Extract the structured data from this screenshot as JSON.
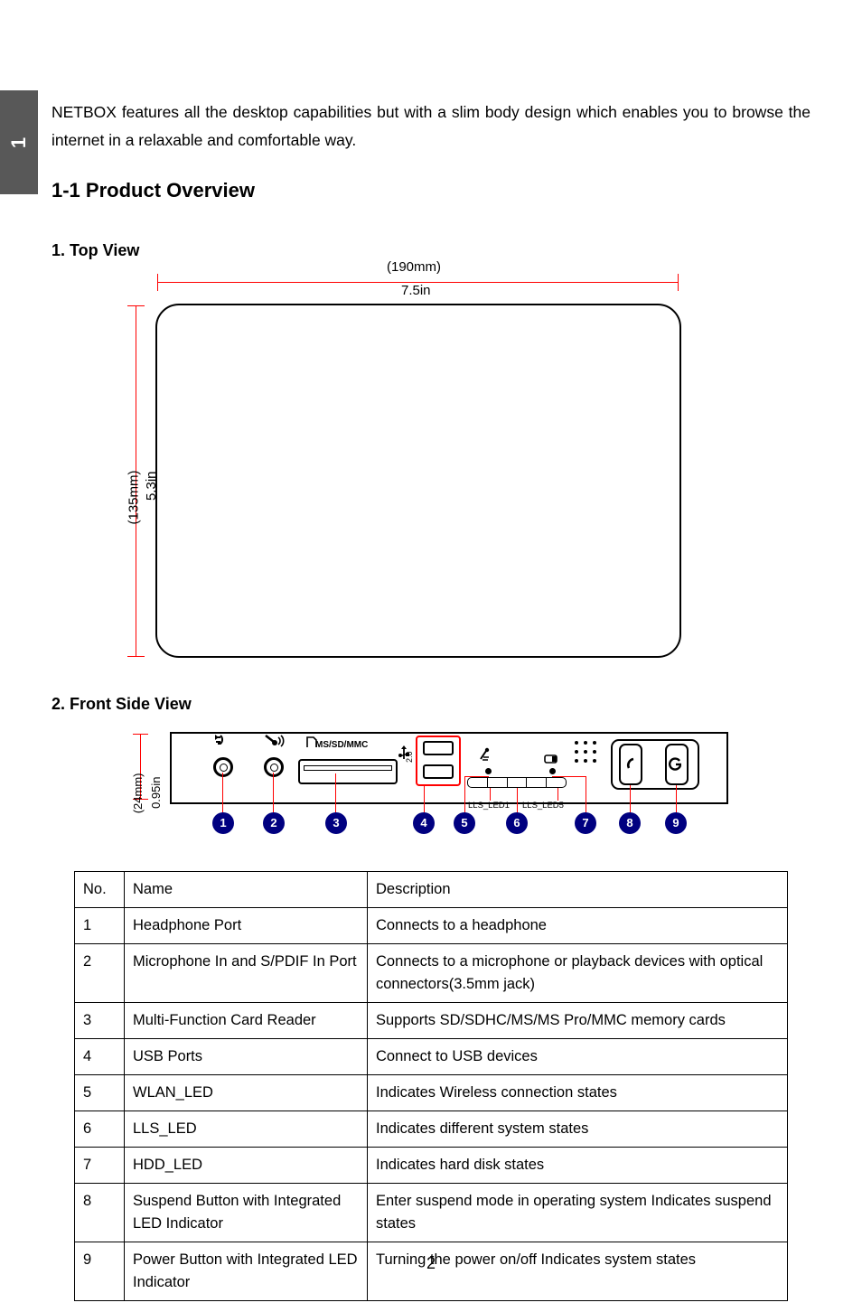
{
  "chapter_tab": {
    "number": "1"
  },
  "intro": {
    "paragraph": "NETBOX features all the desktop capabilities but with a slim body design which enables you to browse the internet in a relaxable and comfortable way."
  },
  "headings": {
    "section": "1-1 Product Overview",
    "top_view": "1. Top View",
    "front_side_view": "2. Front Side View"
  },
  "top_view_diagram": {
    "width_mm": "(190mm)",
    "width_in": "7.5in",
    "height_in": "5.3in",
    "height_mm": "(135mm)"
  },
  "front_view_diagram": {
    "height_in": "0.95in",
    "height_mm": "(24mm)",
    "card_reader_label": "MS/SD/MMC",
    "usb_label": "2.0",
    "led_first_label": "LLS_LED1",
    "led_last_label": "LLS_LED5",
    "icons": {
      "headphone": "headphone-icon",
      "microphone": "microphone-icon",
      "card": "memory-card-icon",
      "usb": "usb-icon",
      "wlan": "wlan-icon",
      "hdd": "hdd-icon",
      "speaker": "speaker-grille-icon",
      "suspend": "moon-icon",
      "power": "power-icon"
    },
    "callouts": [
      "1",
      "2",
      "3",
      "4",
      "5",
      "6",
      "7",
      "8",
      "9"
    ]
  },
  "spec_table": {
    "headers": {
      "no": "No.",
      "name": "Name",
      "description": "Description"
    },
    "rows": [
      {
        "no": "1",
        "name": "Headphone Port",
        "description": "Connects to a headphone"
      },
      {
        "no": "2",
        "name": "Microphone In and S/PDIF In Port",
        "description": "Connects to a microphone or playback devices with optical connectors(3.5mm jack)"
      },
      {
        "no": "3",
        "name": "Multi-Function Card Reader",
        "description": "Supports SD/SDHC/MS/MS Pro/MMC memory cards"
      },
      {
        "no": "4",
        "name": "USB Ports",
        "description": "Connect to USB devices"
      },
      {
        "no": "5",
        "name": "WLAN_LED",
        "description": "Indicates Wireless connection states"
      },
      {
        "no": "6",
        "name": "LLS_LED",
        "description": "Indicates different system states"
      },
      {
        "no": "7",
        "name": "HDD_LED",
        "description": "Indicates hard disk states"
      },
      {
        "no": "8",
        "name": "Suspend Button with Integrated LED Indicator",
        "description": "Enter suspend mode in operating system Indicates suspend states"
      },
      {
        "no": "9",
        "name": "Power Button with Integrated LED Indicator",
        "description": "Turning the power on/off Indicates system states"
      }
    ]
  },
  "footer": {
    "page_number": "2"
  },
  "colors": {
    "dimension_red": "#ff0000",
    "callout_navy": "#000080",
    "tab_gray": "#585858"
  }
}
